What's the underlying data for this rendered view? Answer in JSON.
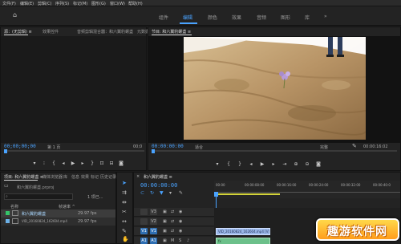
{
  "menu": [
    "文件(F)",
    "编辑(E)",
    "剪辑(C)",
    "序列(S)",
    "标记(M)",
    "图形(G)",
    "窗口(W)",
    "帮助(H)"
  ],
  "workspaces": {
    "tabs": [
      "组件",
      "编辑",
      "颜色",
      "效果",
      "音频",
      "图形",
      "库"
    ],
    "active_index": 1,
    "more": "»"
  },
  "source_panel": {
    "tabs": [
      "源：(无剪辑) ≡",
      "效果控件",
      "音频剪辑混合器：和六翼豹螺盏",
      "元数据"
    ],
    "timecode_left": "00;00;00;00",
    "page": "第 1 页",
    "timecode_right": "00;0"
  },
  "program_panel": {
    "title": "节目: 和六翼豹螺盏 ≡",
    "timecode_left": "00:00:00:00",
    "fit": "适合",
    "full": "完整",
    "timecode_right": "00:00:16:02"
  },
  "project_panel": {
    "tabs": [
      "项目: 和六翼豹螺盏 ≡",
      "媒体浏览器",
      "库",
      "信息",
      "效果",
      "标记",
      "历史记录"
    ],
    "project_file": "和六翼豹螺盏.prproj",
    "search_placeholder": "",
    "selection_count": "1 项已...",
    "col_name": "名称",
    "col_rate": "帧速率 ^",
    "items": [
      {
        "name": "和六翼豹螺盏",
        "rate": "29.97 fps",
        "color": "#35c46a"
      },
      {
        "name": "VID_20160824_162604.mp4",
        "rate": "29.97 fps",
        "color": "#6cb0e6"
      }
    ]
  },
  "timeline_panel": {
    "title": "和六翼豹螺盏 ≡",
    "timecode": "00:00:00:00",
    "ruler": [
      "00:00",
      "00:00:08:00",
      "00:00:16:00",
      "00:00:24:00",
      "00:00:32:00",
      "00:00:40:0"
    ],
    "tracks": [
      {
        "target": "V3",
        "label": "V3"
      },
      {
        "target": "V2",
        "label": "V2"
      },
      {
        "target": "V1",
        "label": "V1"
      },
      {
        "target": "A1",
        "label": "A1"
      }
    ],
    "clip_video": "VID_20160824_162604.mp4 [V]",
    "clip_audio": "fx"
  },
  "watermark": "趣游软件网",
  "colors": {
    "accent": "#4aa3ff",
    "panel_bg": "#232323",
    "app_bg": "#1d1d1d"
  }
}
